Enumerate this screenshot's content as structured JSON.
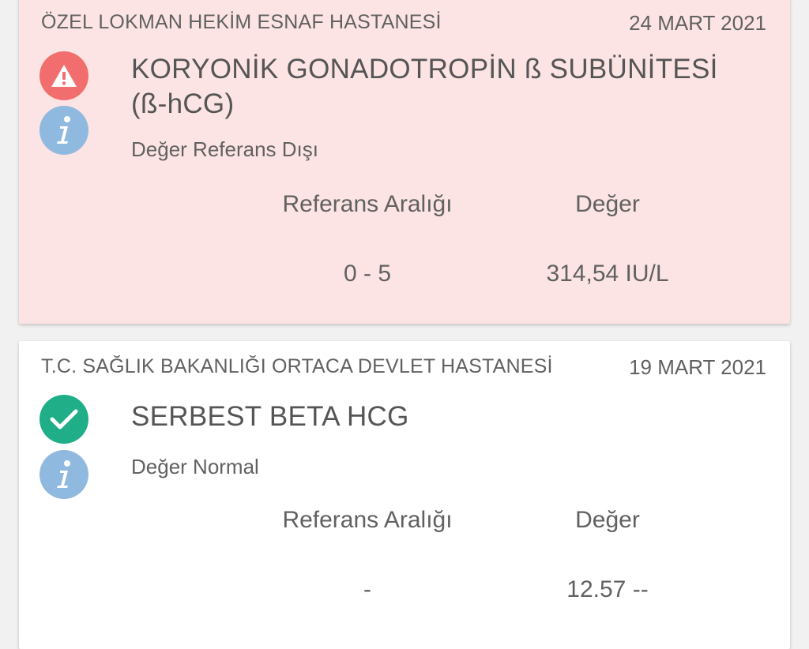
{
  "results": [
    {
      "hospital": "ÖZEL LOKMAN HEKİM ESNAF HASTANESİ",
      "date": "24 MART 2021",
      "status_icon": "warning-icon",
      "test_name": "KORYONİK GONADOTROPİN ß SUBÜNİTESİ (ß-hCG)",
      "status": "Değer Referans Dışı",
      "reference_header": "Referans Aralığı",
      "value_header": "Değer",
      "reference_range": "0 - 5",
      "value": "314,54 IU/L",
      "background": "#fde4e4"
    },
    {
      "hospital": "T.C. SAĞLIK BAKANLIĞI ORTACA DEVLET HASTANESİ",
      "date": "19 MART 2021",
      "status_icon": "check-icon",
      "test_name": "SERBEST BETA HCG",
      "status": "Değer Normal",
      "reference_header": "Referans Aralığı",
      "value_header": "Değer",
      "reference_range": "-",
      "value": "12.57 --",
      "background": "#ffffff"
    }
  ],
  "colors": {
    "warning": "#f26d6d",
    "check": "#1fae87",
    "info": "#8fb9de",
    "text": "#616161"
  }
}
